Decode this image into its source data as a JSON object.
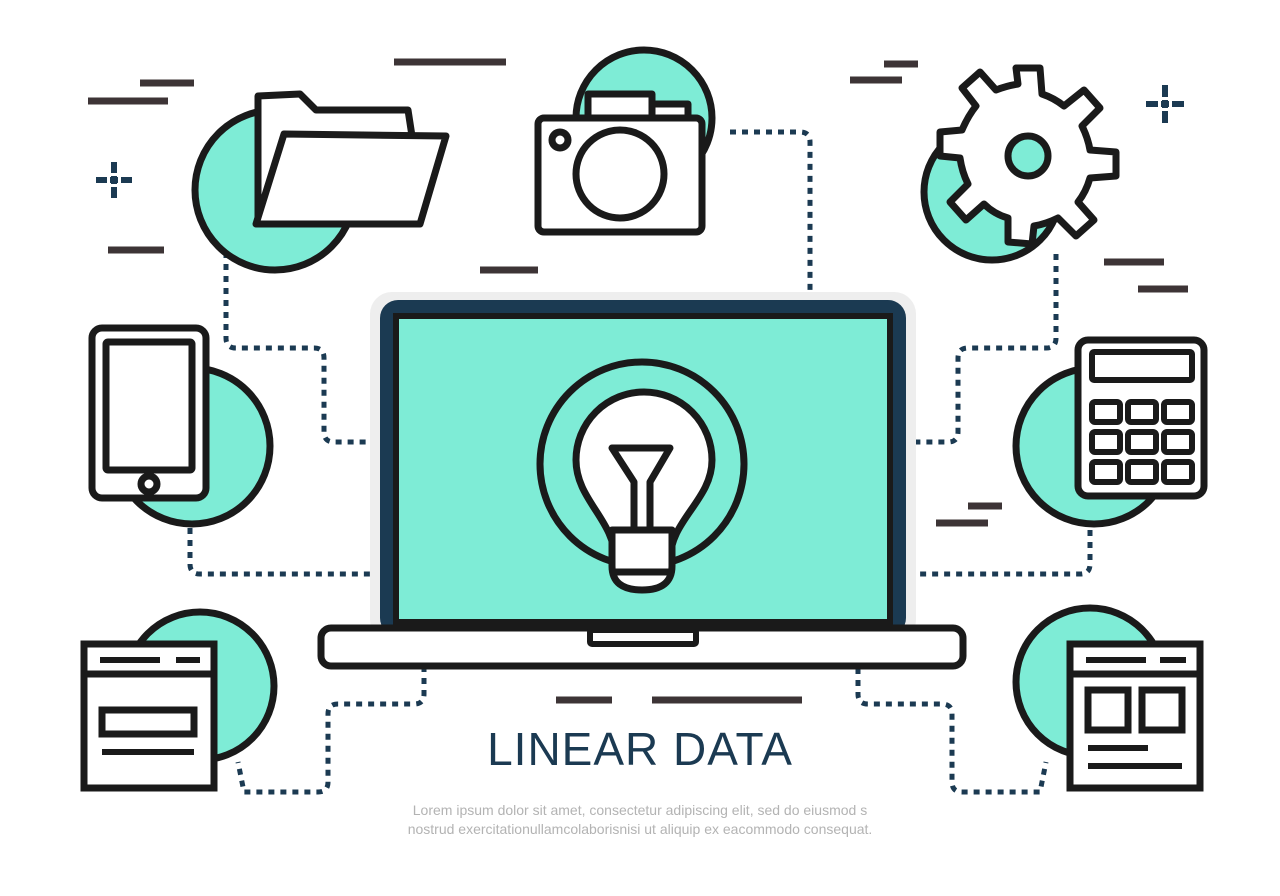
{
  "title": "LINEAR DATA",
  "caption": {
    "line1": "Lorem ipsum dolor  sit  amet, consectetur adipiscing elit,  sed do  eiusmod s",
    "line2": "nostrud exercitationullamcolaborisnisi ut aliquip ex eacommodo consequat."
  },
  "colors": {
    "accent": "#7eecd6",
    "outline": "#1a1a1a",
    "screen_frame": "#1b3a52",
    "connector": "#1b3a52",
    "title": "#1b3a52",
    "caption": "#b3b3b3",
    "decor_lines": "#3d3436"
  },
  "icons": [
    "folder-icon",
    "camera-icon",
    "gear-icon",
    "smartphone-icon",
    "laptop-icon",
    "lightbulb-icon",
    "calculator-icon",
    "browser-window-icon",
    "web-layout-icon"
  ]
}
